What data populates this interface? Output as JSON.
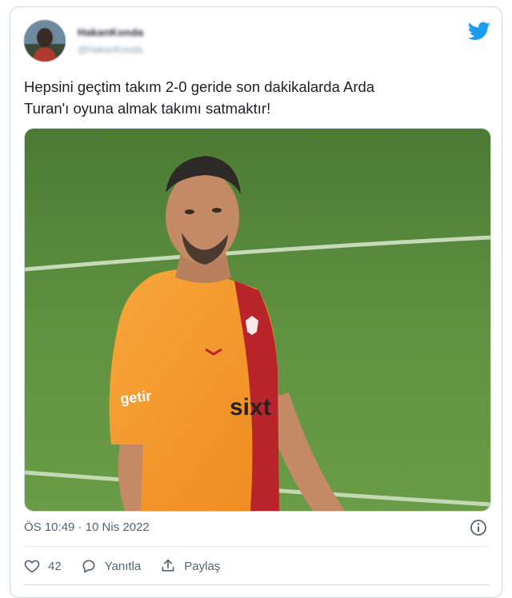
{
  "tweet": {
    "author_name": "HakanKonda",
    "author_handle": "@HakanKonda",
    "text": "Hepsini geçtim takım 2-0 geride son dakikalarda Arda\nTuran'ı oyuna almak takımı satmaktır!",
    "timestamp": "ÖS 10:49 · 10 Nis 2022",
    "like_count": "42",
    "reply_label": "Yanıtla",
    "share_label": "Paylaş"
  },
  "photo": {
    "sponsor_sleeve": "getir",
    "sponsor_chest": "sixt"
  },
  "colors": {
    "brand": "#1d9bf0",
    "muted": "#536471",
    "pitch": "#5a8c3e",
    "jersey_orange": "#f59a2a",
    "jersey_red": "#b8242a"
  },
  "icons": [
    "twitter-bird-icon",
    "info-icon",
    "heart-icon",
    "reply-icon",
    "share-icon"
  ]
}
